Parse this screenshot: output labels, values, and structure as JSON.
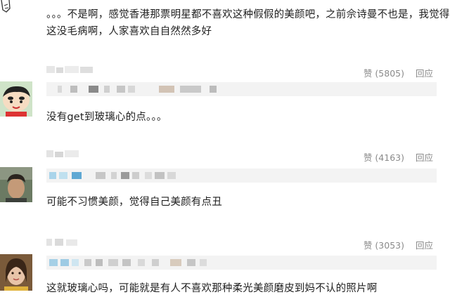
{
  "comments": [
    {
      "text_line1": "。。。不是啊，感觉香港那票明星都不喜欢这种假假的美颜吧，之前佘诗曼不也是，我觉得",
      "text_line2": "这没毛病啊，人家喜欢自自然然多好"
    },
    {
      "likes_label": "赞 (5805)",
      "reply_label": "回应",
      "text": "没有get到玻璃心的点。。。"
    },
    {
      "likes_label": "赞 (4163)",
      "reply_label": "回应",
      "text": "可能不习惯美颜，觉得自己美颜有点丑"
    },
    {
      "likes_label": "赞 (3053)",
      "reply_label": "回应",
      "text": "这就玻璃心吗，可能就是有人不喜欢那种柔光美颜磨皮到妈不认的照片啊"
    }
  ],
  "icons": [
    "cartoon-avatar-icon",
    "crayon-shin-chan-avatar-icon",
    "photo-avatar-icon"
  ],
  "colors": {
    "muted": "#8a8a8a",
    "quote_bg": "#f3f3f3",
    "text": "#1f1f1f"
  }
}
